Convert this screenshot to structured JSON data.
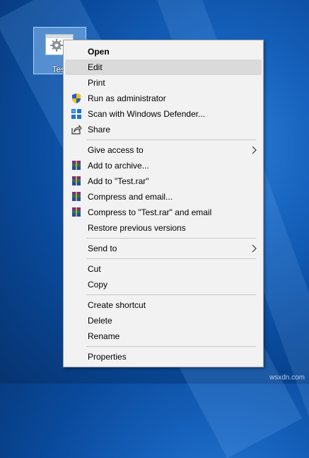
{
  "desktop": {
    "icon_label": "Test"
  },
  "menu": {
    "items": [
      {
        "label": "Open",
        "bold": true
      },
      {
        "label": "Edit",
        "hover": true
      },
      {
        "label": "Print"
      },
      {
        "label": "Run as administrator",
        "icon": "uac-shield-icon"
      },
      {
        "label": "Scan with Windows Defender...",
        "icon": "windows-defender-icon"
      },
      {
        "label": "Share",
        "icon": "share-icon"
      },
      {
        "label": "Give access to",
        "submenu": true
      },
      {
        "label": "Add to archive...",
        "icon": "winrar-icon"
      },
      {
        "label": "Add to \"Test.rar\"",
        "icon": "winrar-icon"
      },
      {
        "label": "Compress and email...",
        "icon": "winrar-icon"
      },
      {
        "label": "Compress to \"Test.rar\" and email",
        "icon": "winrar-icon"
      },
      {
        "label": "Restore previous versions"
      },
      {
        "label": "Send to",
        "submenu": true
      },
      {
        "label": "Cut"
      },
      {
        "label": "Copy"
      },
      {
        "label": "Create shortcut"
      },
      {
        "label": "Delete"
      },
      {
        "label": "Rename"
      },
      {
        "label": "Properties"
      }
    ]
  },
  "watermark": "wsxdn.com",
  "colors": {
    "menu_background": "#f2f2f2",
    "hover_highlight": "#dadada",
    "desktop_background": "#0a4a9c",
    "selection_fill": "#99ccff"
  }
}
